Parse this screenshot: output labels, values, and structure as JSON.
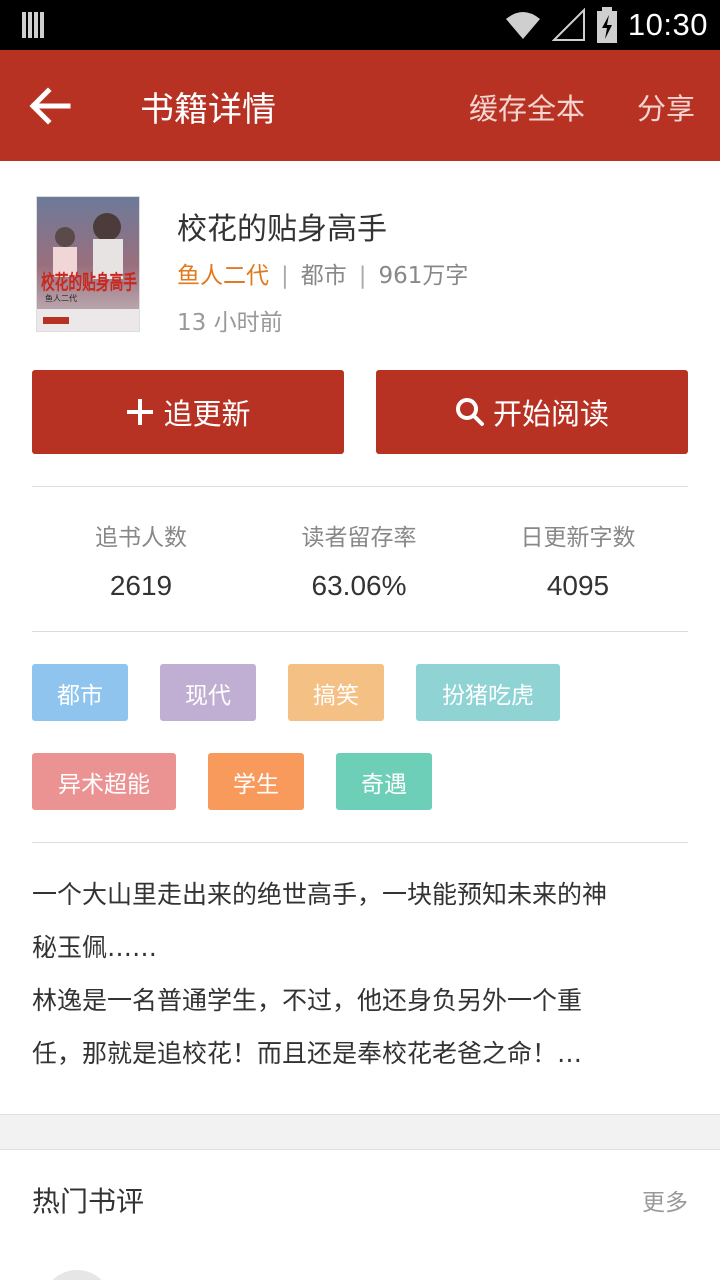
{
  "status_bar": {
    "time": "10:30"
  },
  "app_bar": {
    "title": "书籍详情",
    "actions": {
      "cache": "缓存全本",
      "share": "分享"
    }
  },
  "book": {
    "title": "校花的贴身高手",
    "author": "鱼人二代",
    "category": "都市",
    "word_count": "961万字",
    "updated": "13 小时前",
    "cover_title": "校花的贴身高手",
    "cover_author": "鱼人二代"
  },
  "buttons": {
    "follow": "追更新",
    "read": "开始阅读"
  },
  "stats": [
    {
      "label": "追书人数",
      "value": "2619"
    },
    {
      "label": "读者留存率",
      "value": "63.06%"
    },
    {
      "label": "日更新字数",
      "value": "4095"
    }
  ],
  "tags": [
    {
      "label": "都市",
      "color": "#8ec4ee"
    },
    {
      "label": "现代",
      "color": "#c0afd3"
    },
    {
      "label": "搞笑",
      "color": "#f5c084"
    },
    {
      "label": "扮猪吃虎",
      "color": "#8fd3d4"
    },
    {
      "label": "异术超能",
      "color": "#eb9393"
    },
    {
      "label": "学生",
      "color": "#f89a5c"
    },
    {
      "label": "奇遇",
      "color": "#6ecfb8"
    }
  ],
  "description": {
    "lines": [
      "一个大山里走出来的绝世高手，一块能预知未来的神",
      "秘玉佩……",
      "林逸是一名普通学生，不过，他还身负另外一个重",
      "任，那就是追校花！而且还是奉校花老爸之命！…"
    ]
  },
  "reviews": {
    "title": "热门书评",
    "more": "更多"
  },
  "colors": {
    "primary": "#b83224",
    "author": "#e07a1f"
  }
}
